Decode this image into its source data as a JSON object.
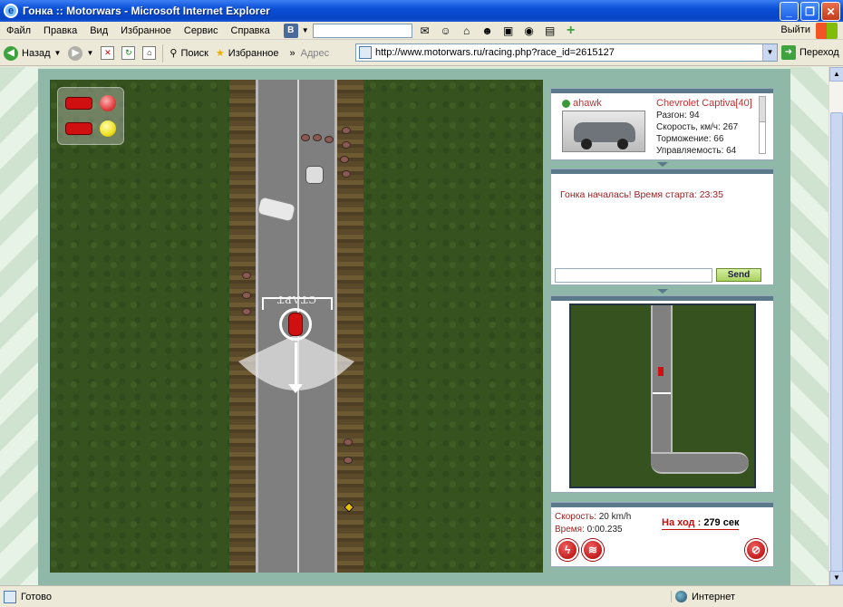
{
  "window": {
    "title": "Гонка :: Motorwars - Microsoft Internet Explorer",
    "min_label": "_",
    "max_label": "❐",
    "close_label": "✕"
  },
  "menu": {
    "items": [
      "Файл",
      "Правка",
      "Вид",
      "Избранное",
      "Сервис",
      "Справка"
    ],
    "vk_logo": "В",
    "exit_label": "Выйти"
  },
  "toolbar": {
    "back_label": "Назад",
    "search_label": "Поиск",
    "favorites_label": "Избранное",
    "address_label": "Адрес",
    "url": "http://www.motorwars.ru/racing.php?race_id=2615127",
    "go_label": "Переход"
  },
  "game": {
    "start_text": "СТАРТ",
    "lights": [
      {
        "color": "#e04040"
      },
      {
        "color": "#f0e020"
      }
    ]
  },
  "player_panel": {
    "name": "ahawk",
    "car": "Chevrolet Captiva[40]",
    "stats": [
      "Разгон: 94",
      "Скорость, км/ч: 267",
      "Торможение: 66",
      "Управляемость: 64"
    ]
  },
  "chat": {
    "message": "Гонка началась! Время старта: 23:35",
    "input_value": "",
    "send_label": "Send"
  },
  "race_info": {
    "speed_label": "Скорость:",
    "speed_value": "20 km/h",
    "time_label": "Время:",
    "time_value": "0:00.235",
    "turn_label": "На ход :",
    "turn_value": "279 сек"
  },
  "statusbar": {
    "status": "Готово",
    "zone": "Интернет"
  }
}
